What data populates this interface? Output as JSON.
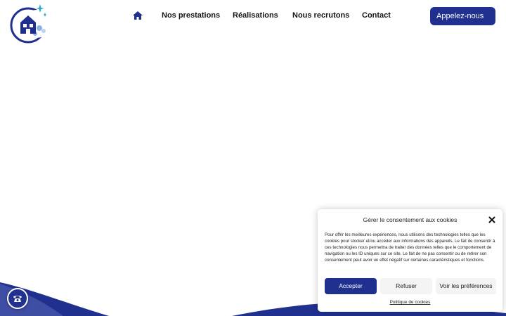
{
  "header": {
    "nav": [
      {
        "label": "Nos prestations"
      },
      {
        "label": "Réalisations"
      },
      {
        "label": "Nous recrutons"
      },
      {
        "label": "Contact"
      }
    ],
    "call_label": "Appelez-nous"
  },
  "cookie": {
    "title": "Gérer le consentement aux cookies",
    "text": "Pour offrir les meilleures expériences, nous utilisons des technologies telles que les cookies pour stocker et/ou accéder aux informations des appareils. Le fait de consentir à ces technologies nous permettra de traiter des données telles que le comportement de navigation ou les ID uniques sur ce site. Le fait de ne pas consentir ou de retirer son consentement peut avoir un effet négatif sur certaines caractéristiques et fonctions.",
    "accept_label": "Accepter",
    "refuse_label": "Refuser",
    "prefs_label": "Voir les préférences",
    "policy_label": "Politique de cookies"
  },
  "colors": {
    "brand": "#20308f",
    "button_light": "#f4f4f4"
  },
  "icons": {
    "home": "home-icon",
    "phone": "phone-icon",
    "close": "close-icon",
    "logo": "logo-icon"
  }
}
